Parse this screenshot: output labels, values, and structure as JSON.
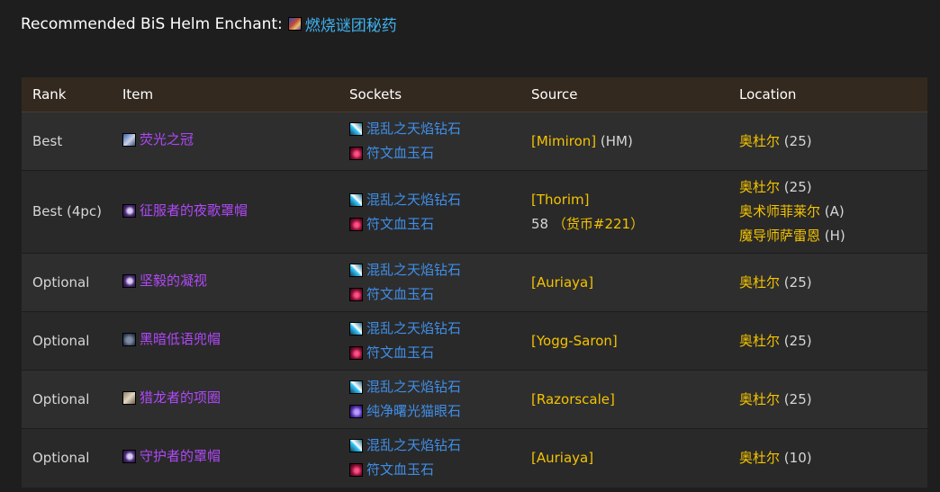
{
  "enchant": {
    "label": "Recommended BiS Helm Enchant:",
    "name": "燃烧谜团秘药",
    "icon": "arcanum-icon"
  },
  "table": {
    "headers": {
      "rank": "Rank",
      "item": "Item",
      "sockets": "Sockets",
      "source": "Source",
      "location": "Location"
    },
    "rows": [
      {
        "rank": "Best",
        "item": "荧光之冠",
        "item_icon": "crown-icon",
        "sockets": [
          "混乱之天焰钻石",
          "符文血玉石"
        ],
        "source": "[Mimiron]",
        "source_note": "(HM)",
        "locations": [
          {
            "name": "奥杜尔",
            "note": "(25)"
          }
        ]
      },
      {
        "rank": "Best (4pc)",
        "item": "征服者的夜歌罩帽",
        "item_icon": "hood-icon",
        "sockets": [
          "混乱之天焰钻石",
          "符文血玉石"
        ],
        "source": "[Thorim]",
        "source_line2_num": "58",
        "source_line2_currency": "（货币#221）",
        "locations": [
          {
            "name": "奥杜尔",
            "note": "(25)"
          },
          {
            "name": "奥术师菲莱尔",
            "note": "(A)"
          },
          {
            "name": "魔导师萨雷恩",
            "note": "(H)"
          }
        ]
      },
      {
        "rank": "Optional",
        "item": "坚毅的凝视",
        "item_icon": "hood-icon",
        "sockets": [
          "混乱之天焰钻石",
          "符文血玉石"
        ],
        "source": "[Auriaya]",
        "locations": [
          {
            "name": "奥杜尔",
            "note": "(25)"
          }
        ]
      },
      {
        "rank": "Optional",
        "item": "黑暗低语兜帽",
        "item_icon": "helm-icon",
        "sockets": [
          "混乱之天焰钻石",
          "符文血玉石"
        ],
        "source": "[Yogg-Saron]",
        "locations": [
          {
            "name": "奥杜尔",
            "note": "(25)"
          }
        ]
      },
      {
        "rank": "Optional",
        "item": "猎龙者的项圈",
        "item_icon": "collar-icon",
        "sockets": [
          "混乱之天焰钻石",
          "纯净曙光猫眼石"
        ],
        "source": "[Razorscale]",
        "locations": [
          {
            "name": "奥杜尔",
            "note": "(25)"
          }
        ]
      },
      {
        "rank": "Optional",
        "item": "守护者的罩帽",
        "item_icon": "hood-icon",
        "sockets": [
          "混乱之天焰钻石",
          "符文血玉石"
        ],
        "source": "[Auriaya]",
        "locations": [
          {
            "name": "奥杜尔",
            "note": "(10)"
          }
        ]
      }
    ]
  }
}
